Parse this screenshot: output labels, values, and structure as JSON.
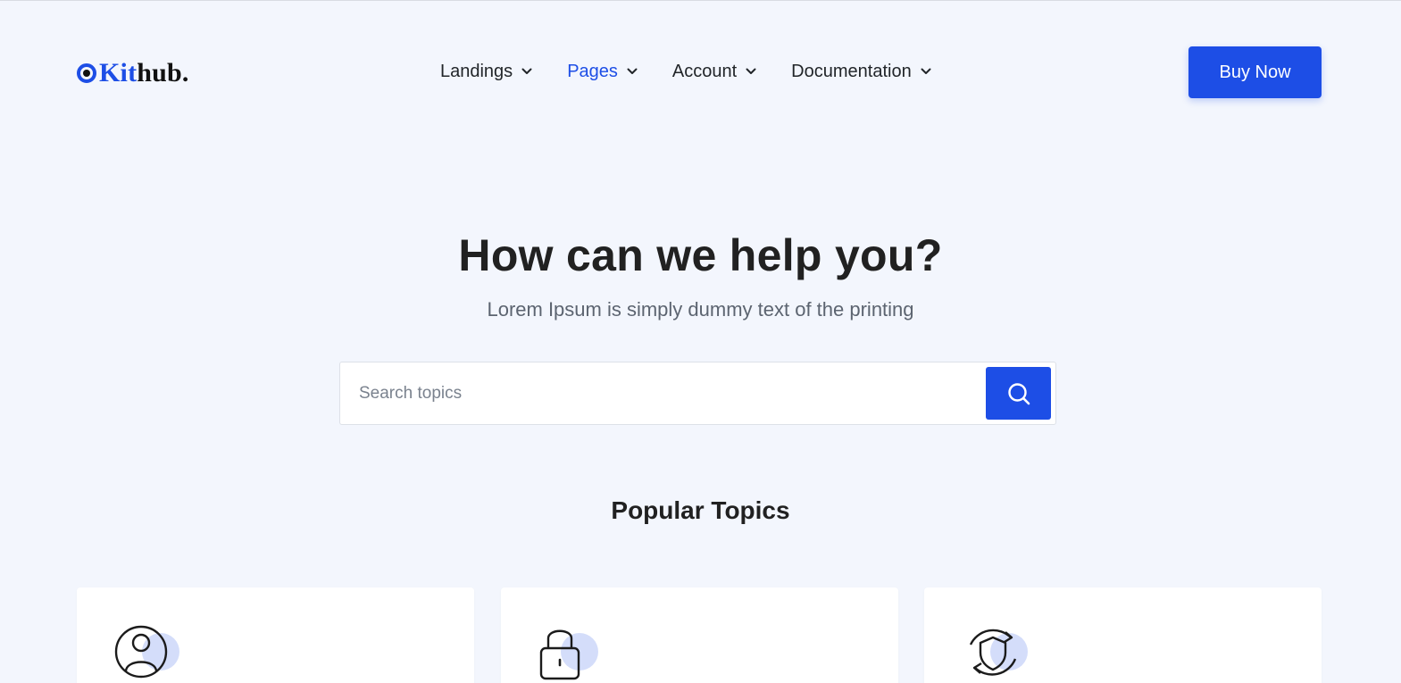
{
  "brand": {
    "prefix": "Kit",
    "suffix": "hub."
  },
  "nav": {
    "items": [
      {
        "label": "Landings",
        "active": false
      },
      {
        "label": "Pages",
        "active": true
      },
      {
        "label": "Account",
        "active": false
      },
      {
        "label": "Documentation",
        "active": false
      }
    ]
  },
  "header": {
    "cta_label": "Buy Now"
  },
  "hero": {
    "title": "How can we help you?",
    "subtitle": "Lorem Ipsum is simply dummy text of the printing"
  },
  "search": {
    "placeholder": "Search topics",
    "value": "",
    "icon": "search-icon"
  },
  "topics": {
    "title": "Popular Topics",
    "cards": [
      {
        "icon": "user-icon"
      },
      {
        "icon": "lock-icon"
      },
      {
        "icon": "shield-refresh-icon"
      }
    ]
  },
  "colors": {
    "accent": "#1d4ee6",
    "background": "#f3f6fd",
    "icon_bubble": "#d4ddfa",
    "text_dark": "#212121",
    "text_muted": "#5c6470"
  }
}
